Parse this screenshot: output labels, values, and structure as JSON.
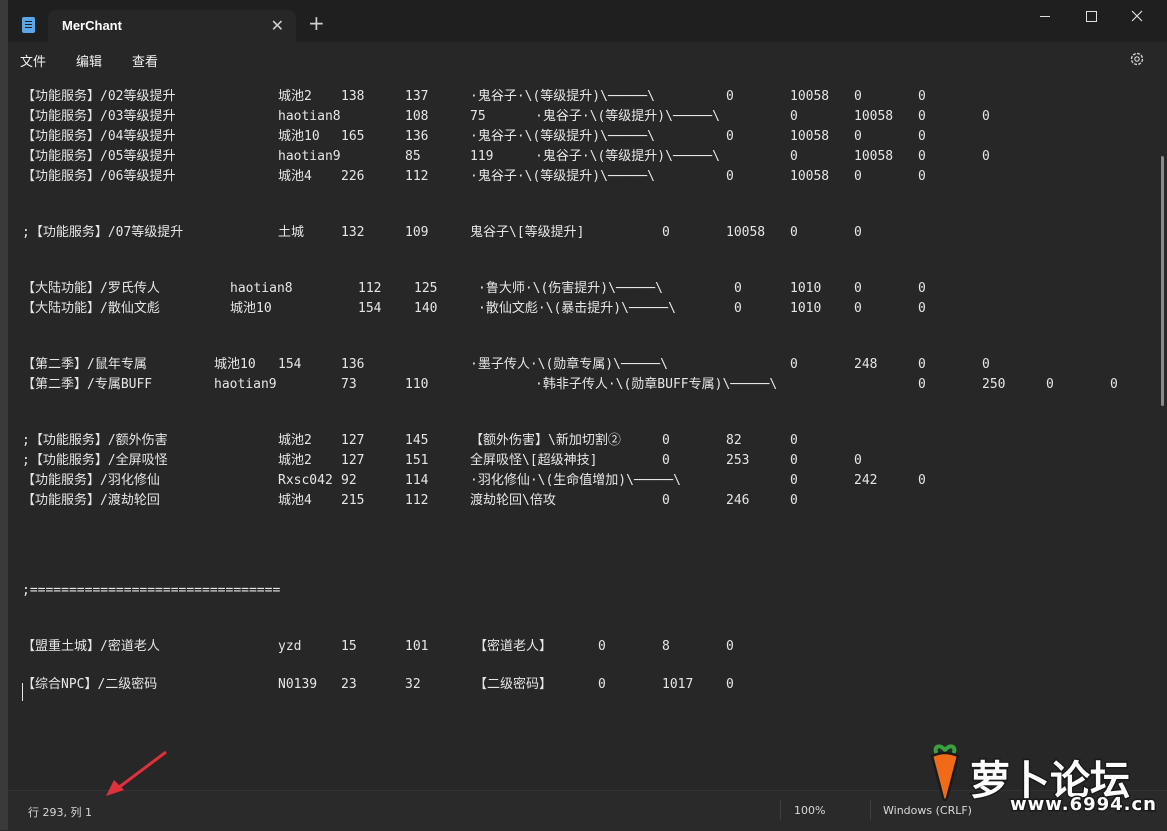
{
  "window": {
    "tab_title": "MerChant",
    "close_tab": "✕",
    "new_tab": "+",
    "menu": [
      "文件",
      "编辑",
      "查看"
    ]
  },
  "colors": {
    "title_bar": "#1f1f1f",
    "editor_bg": "#272727",
    "text": "#e6e6e6",
    "arrow": "#e0303a"
  },
  "editor": {
    "lines": [
      [
        "【功能服务】/02等级提升",
        "城池2",
        "138",
        "137",
        "·鬼谷子·\\(等级提升)\\─────\\",
        "0",
        "10058",
        "0",
        "0"
      ],
      [
        "【功能服务】/03等级提升",
        "haotian8",
        "108",
        "75",
        "·鬼谷子·\\(等级提升)\\─────\\",
        "0",
        "10058",
        "0",
        "0"
      ],
      [
        "【功能服务】/04等级提升",
        "城池10",
        "165",
        "136",
        "·鬼谷子·\\(等级提升)\\─────\\",
        "0",
        "10058",
        "0",
        "0"
      ],
      [
        "【功能服务】/05等级提升",
        "haotian9",
        "85",
        "119",
        "·鬼谷子·\\(等级提升)\\─────\\",
        "0",
        "10058",
        "0",
        "0"
      ],
      [
        "【功能服务】/06等级提升",
        "城池4",
        "226",
        "112",
        "·鬼谷子·\\(等级提升)\\─────\\",
        "0",
        "10058",
        "0",
        "0"
      ],
      [
        ";【功能服务】/07等级提升",
        "土城",
        "132",
        "109",
        "鬼谷子\\[等级提升]",
        "0",
        "10058",
        "0",
        "0"
      ],
      [
        "【大陆功能】/罗氏传人",
        "haotian8",
        "112",
        "125",
        "·鲁大师·\\(伤害提升)\\─────\\",
        "0",
        "1010",
        "0",
        "0"
      ],
      [
        "【大陆功能】/散仙文彪",
        "城池10",
        "154",
        "140",
        "·散仙文彪·\\(暴击提升)\\─────\\",
        "0",
        "1010",
        "0",
        "0"
      ],
      [
        "【第二季】/鼠年专属",
        "城池10",
        "154",
        "136",
        "·墨子传人·\\(勋章专属)\\─────\\",
        "0",
        "248",
        "0",
        "0"
      ],
      [
        "【第二季】/专属BUFF",
        "haotian9",
        "73",
        "110",
        "·韩非子传人·\\(勋章BUFF专属)\\─────\\",
        "0",
        "250",
        "0",
        "0"
      ],
      [
        ";【功能服务】/额外伤害",
        "城池2",
        "127",
        "145",
        "【额外伤害】\\新加切割②",
        "0",
        "82",
        "0"
      ],
      [
        ";【功能服务】/全屏吸怪",
        "城池2",
        "127",
        "151",
        "全屏吸怪\\[超级神技]",
        "0",
        "253",
        "0",
        "0"
      ],
      [
        "【功能服务】/羽化修仙",
        "Rxsc042",
        "92",
        "114",
        "·羽化修仙·\\(生命值增加)\\─────\\",
        "0",
        "242",
        "0"
      ],
      [
        "【功能服务】/渡劫轮回",
        "城池4",
        "215",
        "112",
        "渡劫轮回\\倍攻",
        "0",
        "246",
        "0"
      ],
      [
        ";================================"
      ],
      [
        "【盟重土城】/密道老人",
        "yzd",
        "15",
        "101",
        "【密道老人】",
        "0",
        "8",
        "0"
      ],
      [
        "【综合NPC】/二级密码",
        "N0139",
        "23",
        "32",
        "【二级密码】",
        "0",
        "1017",
        "0"
      ]
    ]
  },
  "status": {
    "position": "行 293, 列 1",
    "zoom": "100%",
    "line_ending": "Windows (CRLF)"
  },
  "watermark": {
    "text": "萝卜论坛",
    "url": "www.6994.cn"
  }
}
